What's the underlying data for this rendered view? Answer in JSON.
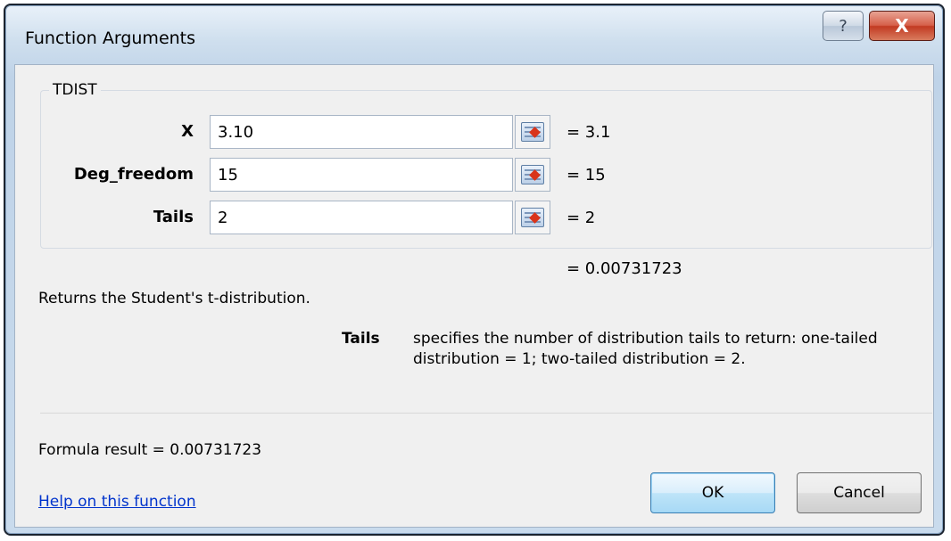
{
  "window": {
    "title": "Function Arguments"
  },
  "titlebar": {
    "help_label": "?",
    "close_label": "X"
  },
  "function": {
    "name": "TDIST",
    "args": [
      {
        "label": "X",
        "value": "3.10",
        "result": "=  3.1"
      },
      {
        "label": "Deg_freedom",
        "value": "15",
        "result": "=  15"
      },
      {
        "label": "Tails",
        "value": "2",
        "result": "=  2"
      }
    ],
    "overall_result": "=  0.00731723",
    "description": "Returns the Student's t-distribution.",
    "arg_help_name": "Tails",
    "arg_help_line1": "specifies the number of distribution tails to return: one-tailed",
    "arg_help_line2": "distribution = 1; two-tailed distribution = 2."
  },
  "footer": {
    "formula_result": "Formula result =  0.00731723",
    "help_link": "Help on this function",
    "ok_label": "OK",
    "cancel_label": "Cancel"
  }
}
